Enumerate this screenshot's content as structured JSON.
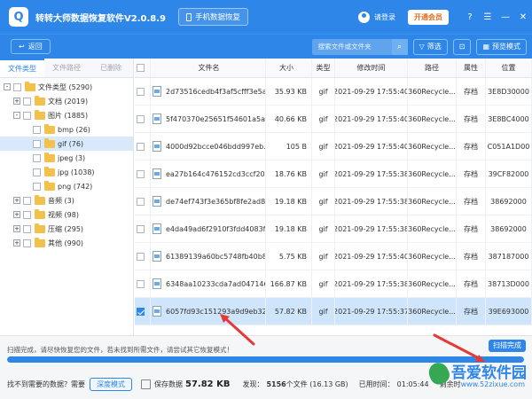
{
  "app": {
    "title": "转转大师数据恢复软件V2.0.8.9",
    "logo_letter": "Q",
    "mobile_recovery": "手机数据恢复",
    "login": "请登录",
    "vip": "开通会员"
  },
  "toolbar": {
    "back": "返回",
    "search_placeholder": "搜索文件或文件夹",
    "filter": "筛选",
    "preview_mode": "预览模式"
  },
  "sidebar": {
    "tabs": [
      {
        "label": "文件类型"
      },
      {
        "label": "文件路径"
      },
      {
        "label": "已删除"
      }
    ],
    "tree": [
      {
        "label": "文件类型 (5290)"
      },
      {
        "label": "文档 (2019)"
      },
      {
        "label": "图片 (1885)"
      },
      {
        "label": "bmp (26)"
      },
      {
        "label": "gif (76)"
      },
      {
        "label": "jpeg (3)"
      },
      {
        "label": "jpg (1038)"
      },
      {
        "label": "png (742)"
      },
      {
        "label": "音频 (3)"
      },
      {
        "label": "视频 (98)"
      },
      {
        "label": "压缩 (295)"
      },
      {
        "label": "其他 (990)"
      }
    ]
  },
  "table": {
    "headers": [
      "文件名",
      "大小",
      "类型",
      "修改时间",
      "路径",
      "属性",
      "位置"
    ],
    "rows": [
      {
        "name": "2d73516cedb4f3af5cfff3e5a...",
        "size": "35.93 KB",
        "type": "gif",
        "time": "2021-09-29 17:55:40",
        "path": "360Recycle...",
        "attr": "存档",
        "pos": "3E8D30000"
      },
      {
        "name": "5f470370e25651f54601a5a6...",
        "size": "40.66 KB",
        "type": "gif",
        "time": "2021-09-29 17:55:40",
        "path": "360Recycle...",
        "attr": "存档",
        "pos": "3E8BC4000"
      },
      {
        "name": "4000d92bcce046bdd997eb...",
        "size": "105 B",
        "type": "gif",
        "time": "2021-09-29 17:55:40",
        "path": "360Recycle...",
        "attr": "存档",
        "pos": "C051A1D00"
      },
      {
        "name": "ea27b164c476152cd3ccf20...",
        "size": "18.76 KB",
        "type": "gif",
        "time": "2021-09-29 17:55:38",
        "path": "360Recycle...",
        "attr": "存档",
        "pos": "39CF82000"
      },
      {
        "name": "de74ef743f3e365bf8fe2ad8...",
        "size": "19.18 KB",
        "type": "gif",
        "time": "2021-09-29 17:55:38",
        "path": "360Recycle...",
        "attr": "存档",
        "pos": "38692000"
      },
      {
        "name": "e4da49ad6f2910f3fdd4083f...",
        "size": "19.18 KB",
        "type": "gif",
        "time": "2021-09-29 17:55:38",
        "path": "360Recycle...",
        "attr": "存档",
        "pos": "38692000"
      },
      {
        "name": "61389139a60bc5748fb40b8...",
        "size": "5.75 KB",
        "type": "gif",
        "time": "2021-09-29 17:55:40",
        "path": "360Recycle...",
        "attr": "存档",
        "pos": "387187000"
      },
      {
        "name": "6348aa10233cda7ad047146...",
        "size": "166.87 KB",
        "type": "gif",
        "time": "2021-09-29 17:55:38",
        "path": "360Recycle...",
        "attr": "存档",
        "pos": "38713D000"
      },
      {
        "name": "6057fd93c151293a9d9eb32...",
        "size": "57.82 KB",
        "type": "gif",
        "time": "2021-09-29 17:55:37",
        "path": "360Recycle...",
        "attr": "存档",
        "pos": "39E693000"
      }
    ]
  },
  "status": {
    "scan_message": "扫描完成，请尽快恢复您的文件，若未找到所需文件，请尝试其它恢复模式！",
    "scan_done": "扫描完成",
    "progress": 1.0,
    "not_found": "找不到需要的数据？需要",
    "deep_scan": "深度模式",
    "save_label": "保存数据",
    "save_size": "57.82 KB",
    "found_label": "发现：",
    "found_count": "5156",
    "found_total": "个文件 (16.13 GB)",
    "elapsed_label": "已用时间：",
    "elapsed": "01:05:44",
    "remaining_label": "剩余时"
  },
  "watermark": {
    "brand": "吾爱软件园",
    "url": "www.52zixue.com"
  },
  "colors": {
    "accent": "#2d86e8",
    "selected": "#cfe5fb",
    "arrow": "#e53935"
  }
}
